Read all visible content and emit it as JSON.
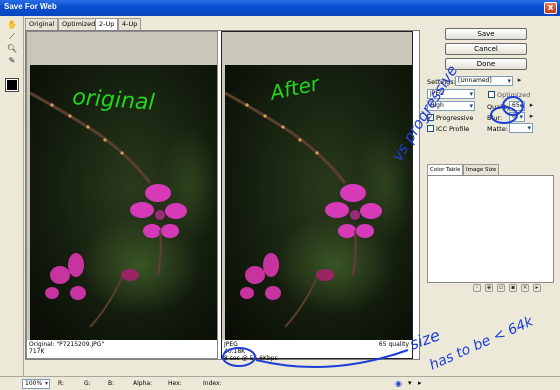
{
  "window": {
    "title": "Save For Web",
    "close_glyph": "x"
  },
  "tabs": [
    {
      "label": "Original",
      "active": false
    },
    {
      "label": "Optimized",
      "active": false
    },
    {
      "label": "2-Up",
      "active": true
    },
    {
      "label": "4-Up",
      "active": false
    }
  ],
  "tools": [
    "hand-tool-icon",
    "slice-select-tool-icon",
    "zoom-tool-icon",
    "eyedropper-tool-icon"
  ],
  "left_pane": {
    "filename_line": "Original: \"P7215209.JPG\"",
    "size": "717K"
  },
  "right_pane": {
    "format": "JPEG",
    "size": "40.18K",
    "time": "8 sec @ 56.6Kbps",
    "quality_note": "65 quality"
  },
  "buttons": {
    "save": "Save",
    "cancel": "Cancel",
    "done": "Done"
  },
  "settings": {
    "label": "Settings:",
    "preset": "[Unnamed]",
    "format": "JPEG",
    "compression": "High",
    "optimized_label": "Optimized",
    "quality_label": "Quality:",
    "quality_value": "65",
    "progressive_label": "Progressive",
    "progressive_checked": true,
    "icc_label": "ICC Profile",
    "icc_checked": false,
    "blur_label": "Blur:",
    "blur_value": "0",
    "matte_label": "Matte:"
  },
  "panel_tabs": [
    {
      "label": "Color Table",
      "active": true
    },
    {
      "label": "Image Size",
      "active": false
    }
  ],
  "statusbar": {
    "zoom": "100%",
    "r_label": "R:",
    "g_label": "G:",
    "b_label": "B:",
    "alpha_label": "Alpha:",
    "hex_label": "Hex:",
    "index_label": "Index:"
  },
  "annotations": {
    "original": "original",
    "after": "After",
    "vs_progressive": "vs progressive",
    "size_note_line1": "size",
    "size_note_line2": "has to be < 64k"
  },
  "colors": {
    "title_bar": "#0a4fd0",
    "annotation_green": "#22d61e",
    "annotation_blue": "#1d3fd6",
    "flower_magenta": "#d63ab8"
  }
}
